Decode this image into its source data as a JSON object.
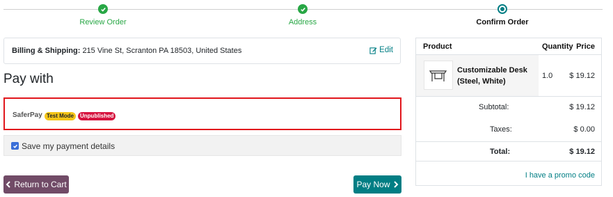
{
  "progress": {
    "steps": [
      {
        "label": "Review Order",
        "state": "done"
      },
      {
        "label": "Address",
        "state": "done"
      },
      {
        "label": "Confirm Order",
        "state": "current"
      }
    ]
  },
  "billing": {
    "label": "Billing & Shipping:",
    "address": "215 Vine St, Scranton PA 18503, United States",
    "edit_label": "Edit"
  },
  "pay_with": {
    "title": "Pay with",
    "provider": {
      "name": "SaferPay",
      "badges": [
        "Test Mode",
        "Unpublished"
      ]
    },
    "save_label": "Save my payment details",
    "save_checked": true
  },
  "actions": {
    "back_label": "Return to Cart",
    "pay_label": "Pay Now"
  },
  "summary": {
    "headers": {
      "product": "Product",
      "quantity": "Quantity",
      "price": "Price"
    },
    "item": {
      "name": "Customizable Desk (Steel, White)",
      "quantity": "1.0",
      "price": "$ 19.12"
    },
    "subtotal_label": "Subtotal:",
    "subtotal": "$ 19.12",
    "taxes_label": "Taxes:",
    "taxes": "$ 0.00",
    "total_label": "Total:",
    "total": "$ 19.12",
    "promo_label": "I have a promo code"
  },
  "colors": {
    "success": "#28a745",
    "primary": "#017e84",
    "secondary": "#714b67",
    "alert_border": "#e1161c"
  }
}
